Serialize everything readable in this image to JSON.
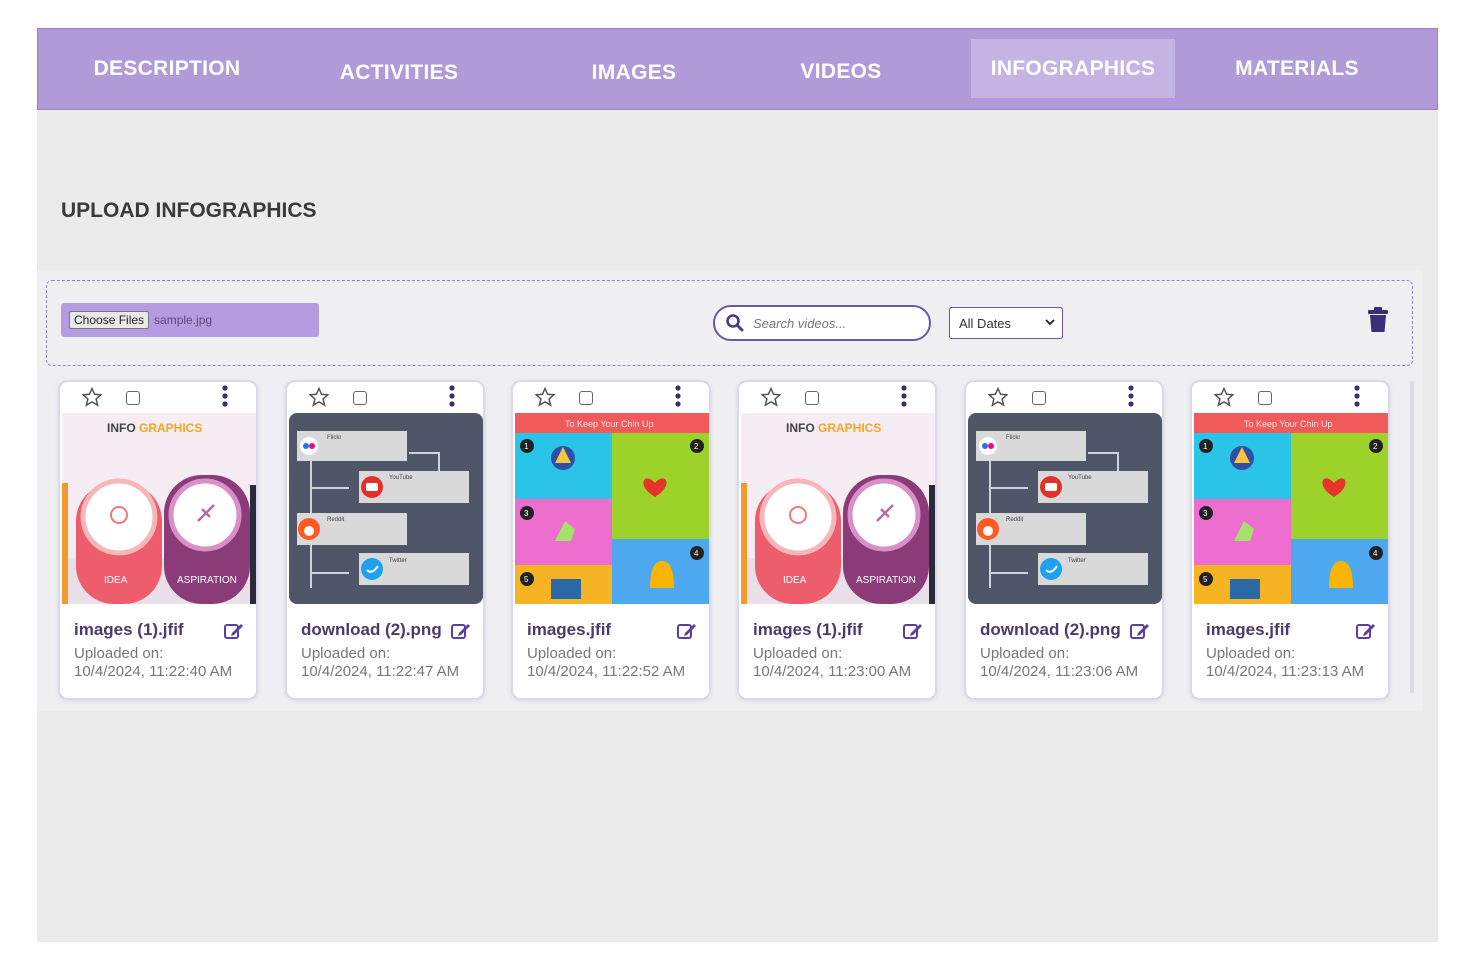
{
  "tabs": [
    {
      "label": "DESCRIPTION",
      "active": false
    },
    {
      "label": "ACTIVITIES",
      "active": false
    },
    {
      "label": "IMAGES",
      "active": false
    },
    {
      "label": "VIDEOS",
      "active": false
    },
    {
      "label": "INFOGRAPHICS",
      "active": true
    },
    {
      "label": "MATERIALS",
      "active": false
    }
  ],
  "section_title": "UPLOAD INFOGRAPHICS",
  "upload": {
    "button_label": "Choose Files",
    "file_name": "sample.jpg"
  },
  "search": {
    "placeholder": "Search videos...",
    "icon": "search-icon"
  },
  "date_filter": {
    "selected": "All Dates"
  },
  "trash_icon": "trash-icon",
  "cards": [
    {
      "file_name": "images (1).jfif",
      "uploaded_label": "Uploaded on:",
      "uploaded_date": "10/4/2024, 11:22:40 AM",
      "thumb": "idea-aspiration"
    },
    {
      "file_name": "download (2).png",
      "uploaded_label": "Uploaded on:",
      "uploaded_date": "10/4/2024, 11:22:47 AM",
      "thumb": "social-flow"
    },
    {
      "file_name": "images.jfif",
      "uploaded_label": "Uploaded on:",
      "uploaded_date": "10/4/2024, 11:22:52 AM",
      "thumb": "chin-up"
    },
    {
      "file_name": "images (1).jfif",
      "uploaded_label": "Uploaded on:",
      "uploaded_date": "10/4/2024, 11:23:00 AM",
      "thumb": "idea-aspiration"
    },
    {
      "file_name": "download (2).png",
      "uploaded_label": "Uploaded on:",
      "uploaded_date": "10/4/2024, 11:23:06 AM",
      "thumb": "social-flow"
    },
    {
      "file_name": "images.jfif",
      "uploaded_label": "Uploaded on:",
      "uploaded_date": "10/4/2024, 11:23:13 AM",
      "thumb": "chin-up"
    }
  ],
  "thumb_text": {
    "idea_aspiration": {
      "title_a": "INFO",
      "title_b": "GRAPHICS",
      "left": "IDEA",
      "right": "ASPIRATION"
    },
    "social_flow": {
      "items": [
        "Flickr",
        "YouTube",
        "Reddit",
        "Twitter"
      ]
    },
    "chin_up": {
      "banner": "To Keep Your Chin Up",
      "numbers": [
        "1",
        "2",
        "3",
        "4",
        "5"
      ]
    }
  },
  "colors": {
    "accent": "#b09ad8",
    "accent_dark": "#4b3a6b",
    "active_tab": "#c4b3e3"
  }
}
